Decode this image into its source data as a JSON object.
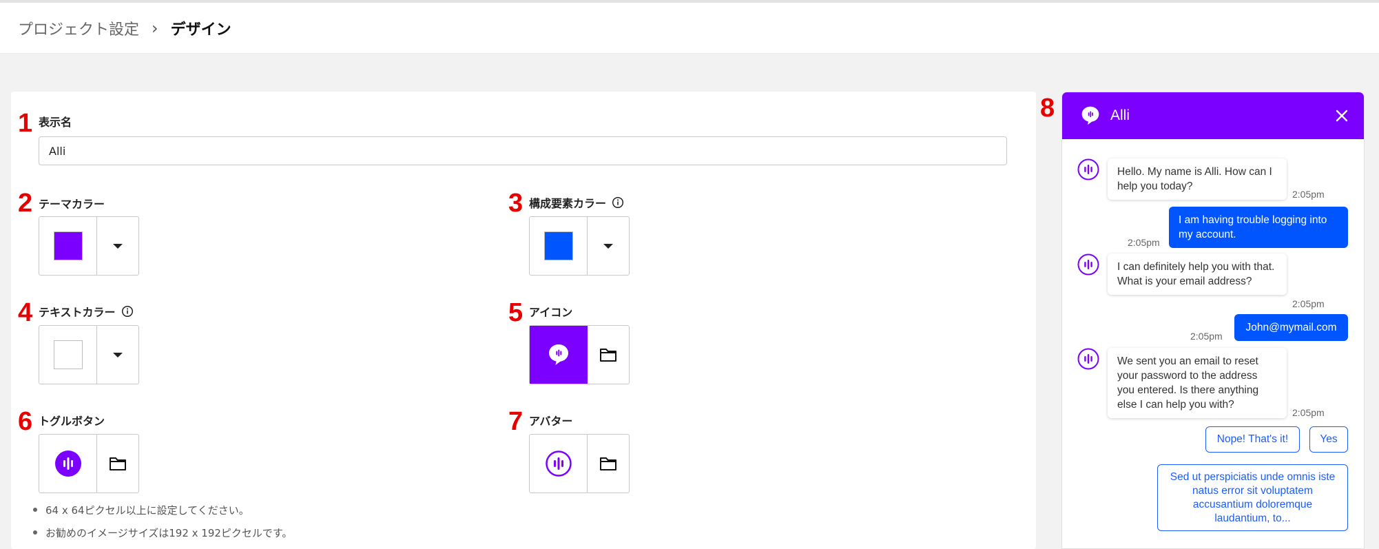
{
  "breadcrumb": {
    "parent": "プロジェクト設定",
    "separator": "›",
    "current": "デザイン"
  },
  "fields": {
    "display_name": {
      "number": "1",
      "label": "表示名",
      "value": "Alli"
    },
    "theme_color": {
      "number": "2",
      "label": "テーマカラー",
      "color": "#7b00ff"
    },
    "component_color": {
      "number": "3",
      "label": "構成要素カラー",
      "color": "#0055ff"
    },
    "text_color": {
      "number": "4",
      "label": "テキストカラー",
      "color": "#ffffff"
    },
    "icon": {
      "number": "5",
      "label": "アイコン"
    },
    "toggle_button": {
      "number": "6",
      "label": "トグルボタン"
    },
    "avatar": {
      "number": "7",
      "label": "アバター"
    }
  },
  "notes": [
    "64 x 64ピクセル以上に設定してください。",
    "お勧めのイメージサイズは192 x 192ピクセルです。"
  ],
  "preview": {
    "number": "8",
    "title": "Alli",
    "header_color": "#7b00ff",
    "messages": [
      {
        "from": "bot",
        "text": "Hello. My name is Alli. How can I help you today?",
        "time": "2:05pm"
      },
      {
        "from": "user",
        "text": "I am having trouble logging into my account.",
        "time": "2:05pm"
      },
      {
        "from": "bot",
        "text": "I can definitely help you with that. What is your email address?",
        "time": "2:05pm"
      },
      {
        "from": "user",
        "text": "John@mymail.com",
        "time": "2:05pm"
      },
      {
        "from": "bot",
        "text": "We sent you an email to reset your password to the address you entered. Is there anything else I can help you with?",
        "time": "2:05pm"
      }
    ],
    "quick_replies": [
      "Nope! That's it!",
      "Yes",
      "Sed ut perspiciatis unde omnis iste natus error sit voluptatem accusantium doloremque laudantium, to..."
    ]
  },
  "icons": {
    "info": "info-icon",
    "dropdown": "caret-down-icon",
    "folder": "folder-icon",
    "close": "close-icon",
    "brand": "alli-speech-bubble-icon"
  }
}
